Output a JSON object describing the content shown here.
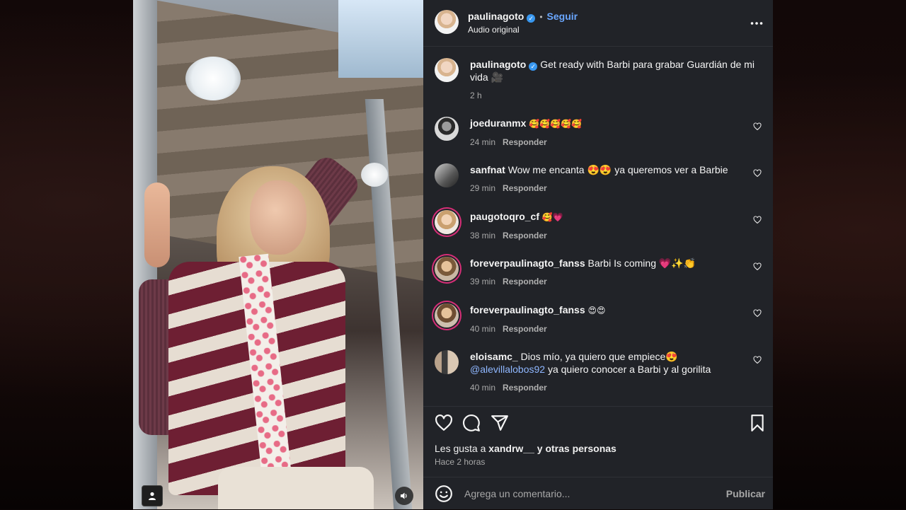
{
  "post": {
    "author": "paulinagoto",
    "verified": true,
    "follow_label": "Seguir",
    "audio_label": "Audio original",
    "caption": "Get ready with Barbi para grabar Guardián de mi vida 🎥",
    "caption_time": "2 h",
    "likes_prefix": "Les gusta a",
    "likes_user": "xandrw__",
    "likes_suffix": "y otras personas",
    "posted_ago": "Hace 2 horas"
  },
  "comments": [
    {
      "user": "joeduranmx",
      "text": "🥰🥰🥰🥰🥰",
      "time": "24 min",
      "reply_label": "Responder"
    },
    {
      "user": "sanfnat",
      "text": "Wow me encanta 😍😍 ya queremos ver a Barbie",
      "time": "29 min",
      "reply_label": "Responder"
    },
    {
      "user": "paugotoqro_cf",
      "text": "🥰💗",
      "time": "38 min",
      "reply_label": "Responder"
    },
    {
      "user": "foreverpaulinagto_fanss",
      "text": "Barbi Is coming 💗✨👏",
      "time": "39 min",
      "reply_label": "Responder"
    },
    {
      "user": "foreverpaulinagto_fanss",
      "text": "😍😍",
      "time": "40 min",
      "reply_label": "Responder"
    },
    {
      "user": "eloisamc_",
      "text": "Dios mío, ya quiero que empiece😍",
      "mention": "@alevillalobos92",
      "text2": "ya quiero conocer a Barbi y al gorilita",
      "time": "40 min",
      "reply_label": "Responder"
    }
  ],
  "composer": {
    "placeholder": "Agrega un comentario...",
    "publish_label": "Publicar"
  },
  "colors": {
    "panel_bg": "#212328",
    "link_blue": "#6aa7ff",
    "verified_blue": "#3897f0",
    "story_ring": "#d62e77"
  },
  "icons": [
    "more-options-icon",
    "heart-icon",
    "comment-icon",
    "share-icon",
    "bookmark-icon",
    "emoji-icon",
    "user-tag-icon",
    "speaker-icon",
    "verified-icon"
  ]
}
